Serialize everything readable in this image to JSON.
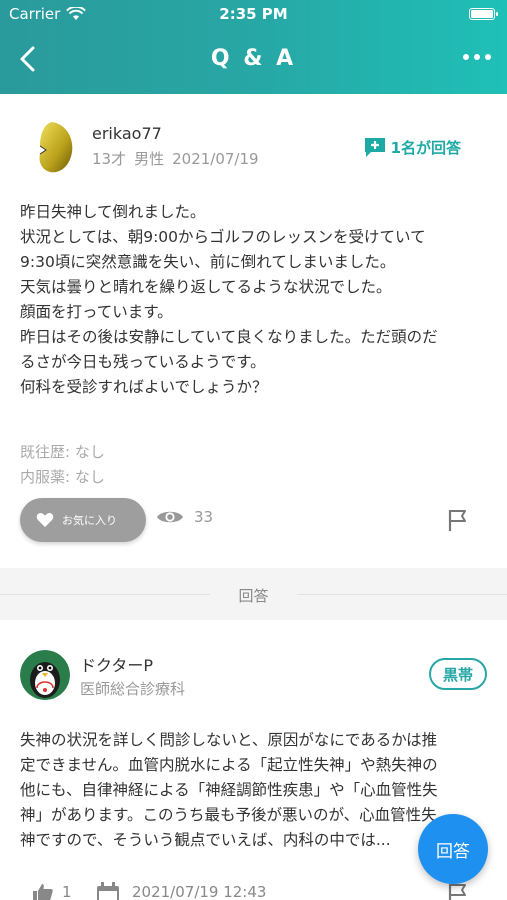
{
  "status_bar": {
    "carrier": "Carrier",
    "time": "2:35 PM"
  },
  "nav": {
    "title": "Q & A"
  },
  "question": {
    "username": "erikao77",
    "age": "13才",
    "gender": "男性",
    "date": "2021/07/19",
    "answer_count_label": "1名が回答",
    "body_lines": [
      "昨日失神して倒れました。",
      "状況としては、朝9:00からゴルフのレッスンを受けていて",
      "9:30頃に突然意識を失い、前に倒れてしまいました。",
      "天気は曇りと晴れを繰り返してるような状況でした。",
      "顔面を打っています。",
      "昨日はその後は安静にしていて良くなりました。ただ頭のだ",
      "るさが今日も残っているようです。",
      "何科を受診すればよいでしょうか？"
    ],
    "history": "既往歴: なし",
    "medication": "内服薬: なし",
    "favorite_label": "お気に入り",
    "view_count": "33"
  },
  "divider": {
    "label": "回答"
  },
  "answer": {
    "name": "ドクターP",
    "department": "医師総合診療科",
    "badge": "黒帯",
    "body_lines": [
      "失神の状況を詳しく問診しないと、原因がなにであるかは推",
      "定できません。血管内脱水による「起立性失神」や熱失神の",
      "他にも、自律神経による「神経調節性疾患」や「心血管性失",
      "神」があります。このうち最も予後が悪いのが、心血管性失",
      "神ですので、そういう観点でいえば、内科の中では..."
    ],
    "like_count": "1",
    "date": "2021/07/19 12:43"
  },
  "fab": {
    "label": "回答"
  },
  "colors": {
    "header_start": "#2a9a9c",
    "header_end": "#1fc0b7",
    "accent": "#27a7a5",
    "fab": "#1e90f0",
    "favorite_button": "#9e9e9e"
  },
  "icons": [
    "wifi-icon",
    "battery-icon",
    "back-arrow-icon",
    "more-icon",
    "add-comment-icon",
    "heart-icon",
    "eye-icon",
    "flag-icon",
    "like-icon",
    "calendar-icon"
  ]
}
